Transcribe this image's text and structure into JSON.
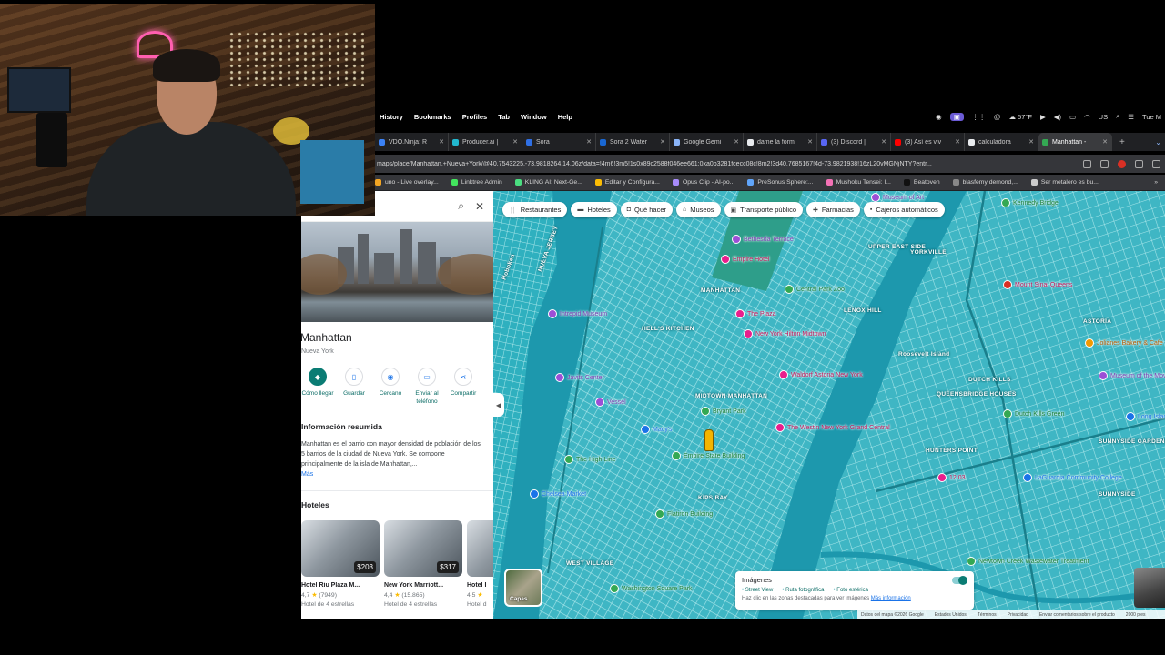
{
  "menubar": {
    "items": [
      "History",
      "Bookmarks",
      "Profiles",
      "Tab",
      "Window",
      "Help"
    ],
    "status": {
      "weather": "57°F",
      "time": "Tue M",
      "flag": "US"
    }
  },
  "tabs": [
    {
      "label": "VDO.Ninja: R",
      "color": "#3b82f6"
    },
    {
      "label": "Producer.ai |",
      "color": "#22b8cf"
    },
    {
      "label": "Sora",
      "color": "#2f6fe4"
    },
    {
      "label": "Sora 2 Water",
      "color": "#1967d2"
    },
    {
      "label": "Google Gemi",
      "color": "#8ab4f8"
    },
    {
      "label": "dame la form",
      "color": "#e8eaed"
    },
    {
      "label": "(3) Discord |",
      "color": "#5865f2"
    },
    {
      "label": "(3) Así es viv",
      "color": "#ff0000"
    },
    {
      "label": "calculadora",
      "color": "#e8eaed"
    },
    {
      "label": "Manhattan -",
      "color": "#34a853",
      "active": true
    }
  ],
  "address": {
    "url": "maps/place/Manhattan,+Nueva+York/@40.7543225,-73.9818264,14.06z/data=!4m6!3m5!1s0x89c2588f046ee661:0xa0b3281fcecc08c!8m2!3d40.7685167!4d-73.9821938!16zL20vMGNjNTY?entr..."
  },
  "bookmarks": [
    {
      "label": "uno - Live overlay...",
      "color": "#f5a623"
    },
    {
      "label": "Linktree Admin",
      "color": "#43e55e"
    },
    {
      "label": "KLING AI: Next-Ge...",
      "color": "#4ade80"
    },
    {
      "label": "Editar y Configura...",
      "color": "#fbbc04"
    },
    {
      "label": "Opus Clip - AI-po...",
      "color": "#a78bfa"
    },
    {
      "label": "PreSonus Sphere:...",
      "color": "#60a5fa"
    },
    {
      "label": "Mushoku Tensei: I...",
      "color": "#f472b6"
    },
    {
      "label": "Beatoven",
      "color": "#111111"
    },
    {
      "label": "blasfemy demond,...",
      "color": "#888888"
    },
    {
      "label": "Ser metalero es bu...",
      "color": "#cccccc"
    }
  ],
  "panel": {
    "place_name": "Manhattan",
    "place_sub": "Nueva York",
    "actions": [
      {
        "label": "Cómo llegar",
        "icon": "directions-icon",
        "glyph": "◆",
        "primary": true
      },
      {
        "label": "Guardar",
        "icon": "bookmark-icon",
        "glyph": "▯"
      },
      {
        "label": "Cercano",
        "icon": "nearby-icon",
        "glyph": "◉"
      },
      {
        "label": "Enviar al teléfono",
        "icon": "phone-icon",
        "glyph": "▭"
      },
      {
        "label": "Compartir",
        "icon": "share-icon",
        "glyph": "⋖"
      }
    ],
    "summary_title": "Información resumida",
    "summary_text": "Manhattan es el barrio con mayor densidad de población de los 5 barrios de la ciudad de Nueva York. Se compone principalmente de la isla de Manhattan,...",
    "more": "Más",
    "hotels_title": "Hoteles",
    "hotels": [
      {
        "name": "Hotel Riu Plaza M...",
        "price": "$203",
        "rating": "4,7",
        "reviews": "(7949)",
        "class": "Hotel de 4 estrellas"
      },
      {
        "name": "New York Marriott...",
        "price": "$317",
        "rating": "4,4",
        "reviews": "(15.865)",
        "class": "Hotel de 4 estrellas"
      },
      {
        "name": "Hotel I",
        "price": "",
        "rating": "4,5",
        "reviews": "",
        "class": "Hotel d"
      }
    ]
  },
  "map": {
    "chips": [
      {
        "label": "Restaurantes",
        "icon": "fork-icon",
        "glyph": "🍴"
      },
      {
        "label": "Hoteles",
        "icon": "bed-icon",
        "glyph": "▬"
      },
      {
        "label": "Qué hacer",
        "icon": "camera-icon",
        "glyph": "◘"
      },
      {
        "label": "Museos",
        "icon": "museum-icon",
        "glyph": "⌂"
      },
      {
        "label": "Transporte público",
        "icon": "transit-icon",
        "glyph": "▣"
      },
      {
        "label": "Farmacias",
        "icon": "pharmacy-icon",
        "glyph": "✚"
      },
      {
        "label": "Cajeros automáticos",
        "icon": "atm-icon",
        "glyph": "▪"
      }
    ],
    "area_labels": [
      "MANHATTAN",
      "HELL'S KITCHEN",
      "MIDTOWN MANHATTAN",
      "UPPER EAST SIDE",
      "LENOX HILL",
      "YORKVILLE",
      "ASTORIA",
      "DUTCH KILLS",
      "QUEENSBRIDGE HOUSES",
      "HUNTERS POINT",
      "SUNNYSIDE GARDENS",
      "SUNNYSIDE",
      "KIPS BAY",
      "WEST VILLAGE",
      "Roosevelt Island",
      "NUEVA JERSEY",
      "Hoboken"
    ],
    "pois": [
      {
        "label": "Empire Hotel",
        "kind": "pink"
      },
      {
        "label": "Bethesda Terrace",
        "kind": "purple"
      },
      {
        "label": "Central Park Zoo",
        "kind": "green"
      },
      {
        "label": "Intrepid Museum",
        "kind": "purple"
      },
      {
        "label": "The Plaza",
        "kind": "pink"
      },
      {
        "label": "New York Hilton Midtown",
        "kind": "pink"
      },
      {
        "label": "Waldorf Astoria New York",
        "kind": "pink"
      },
      {
        "label": "Javits Center",
        "kind": "purple"
      },
      {
        "label": "Vessel",
        "kind": "purple"
      },
      {
        "label": "Macy's",
        "kind": "blue"
      },
      {
        "label": "The Westin New York Grand Central",
        "kind": "pink"
      },
      {
        "label": "Empire State Building",
        "kind": "green"
      },
      {
        "label": "Bryant Park",
        "kind": "green"
      },
      {
        "label": "Chelsea Market",
        "kind": "blue"
      },
      {
        "label": "The High Line",
        "kind": "green"
      },
      {
        "label": "Flatiron Building",
        "kind": "green"
      },
      {
        "label": "Mount Sinai Queens",
        "kind": "red"
      },
      {
        "label": "Museum of the Moving Image",
        "kind": "purple"
      },
      {
        "label": "Jolianes Bakery & Cafe",
        "kind": "orange"
      },
      {
        "label": "Kennedy Bridge",
        "kind": "green"
      },
      {
        "label": "Museum of Art",
        "kind": "purple"
      },
      {
        "label": "LaGuardia Community College",
        "kind": "blue"
      },
      {
        "label": "Dutch Kills Green",
        "kind": "green"
      },
      {
        "label": "Washington Square Park",
        "kind": "green"
      },
      {
        "label": "Newtown Creek Wastewater Treatment",
        "kind": "green"
      },
      {
        "label": "12:03",
        "kind": "pink"
      },
      {
        "label": "Long Island Rail",
        "kind": "blue"
      }
    ],
    "layers_label": "Capas",
    "images_panel": {
      "title": "Imágenes",
      "options": [
        "Street View",
        "Ruta fotográfica",
        "Foto esférica"
      ],
      "note": "Haz clic en las zonas destacadas para ver imágenes",
      "link": "Más información"
    },
    "footer": [
      "Datos del mapa ©2026 Google",
      "Estados Unidos",
      "Términos",
      "Privacidad",
      "Enviar comentarios sobre el producto",
      "2000 pies"
    ]
  }
}
